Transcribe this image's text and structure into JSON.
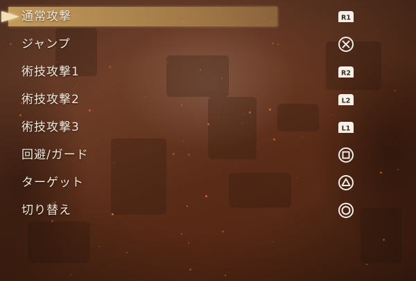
{
  "menu": {
    "items": [
      {
        "label": "通常攻撃",
        "button": "R1",
        "button_icon": "r1-button-icon",
        "selected": true
      },
      {
        "label": "ジャンプ",
        "button": "cross",
        "button_icon": "cross-button-icon",
        "selected": false
      },
      {
        "label": "術技攻撃1",
        "button": "R2",
        "button_icon": "r2-button-icon",
        "selected": false
      },
      {
        "label": "術技攻撃2",
        "button": "L2",
        "button_icon": "l2-button-icon",
        "selected": false
      },
      {
        "label": "術技攻撃3",
        "button": "L1",
        "button_icon": "l1-button-icon",
        "selected": false
      },
      {
        "label": "回避/ガード",
        "button": "square",
        "button_icon": "square-button-icon",
        "selected": false
      },
      {
        "label": "ターゲット",
        "button": "triangle",
        "button_icon": "triangle-button-icon",
        "selected": false
      },
      {
        "label": "切り替え",
        "button": "circle",
        "button_icon": "circle-button-icon",
        "selected": false
      }
    ]
  },
  "colors": {
    "highlight": "#c8a05f",
    "text": "#f3e9da",
    "icon": "#f5f0e8",
    "cursor": "#f2e0b5"
  }
}
